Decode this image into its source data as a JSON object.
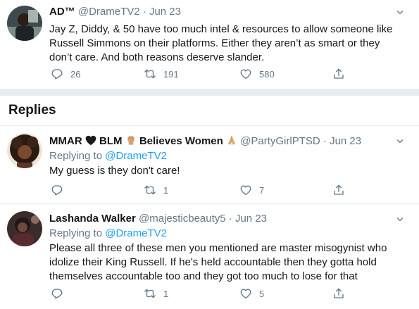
{
  "main_tweet": {
    "name": "AD™",
    "handle": "@DrameTV2",
    "dot": "·",
    "date": "Jun 23",
    "text": "Jay Z, Diddy, & 50 have too much intel & resources to allow someone like Russell Simmons on their platforms. Either they aren’t as smart or they don’t care. And both reasons deserve slander.",
    "replies": "26",
    "retweets": "191",
    "likes": "580"
  },
  "replies_heading": "Replies",
  "replies": [
    {
      "name_a": "MMAR",
      "name_b": "BLM",
      "name_c": "Believes Women",
      "handle": "@PartyGirlPTSD",
      "dot": "·",
      "date": "Jun 23",
      "replying_to_label": "Replying to",
      "replying_to_handle": "@DrameTV2",
      "text": "My guess is they don't care!",
      "replies": "",
      "retweets": "1",
      "likes": "7"
    },
    {
      "name": "Lashanda Walker",
      "handle": "@majesticbeauty5",
      "dot": "·",
      "date": "Jun 23",
      "replying_to_label": "Replying to",
      "replying_to_handle": "@DrameTV2",
      "text": "Please all three of these men you mentioned are master misogynist who idolize their King Russell. If he's held accountable then they gotta hold themselves accountable too and they got too much to lose for that",
      "replies": "",
      "retweets": "1",
      "likes": "5"
    }
  ],
  "colors": {
    "text": "#14171a",
    "muted": "#657786",
    "link": "#1da1f2",
    "divider": "#e6ecf0"
  },
  "icons": [
    "reply-icon",
    "retweet-icon",
    "like-icon",
    "share-icon",
    "chevron-down-icon",
    "black-heart-icon",
    "raised-fist-icon",
    "folded-hands-icon"
  ]
}
